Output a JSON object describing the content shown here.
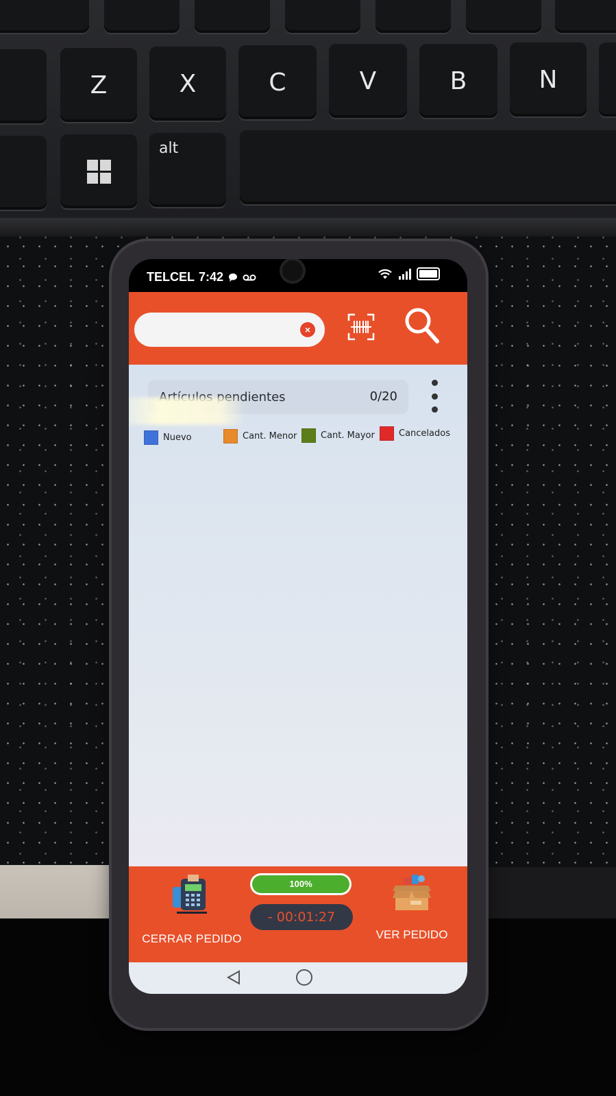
{
  "keyboard": {
    "row1": [
      "Z",
      "X",
      "C",
      "V",
      "B",
      "N"
    ],
    "alt_label": "alt"
  },
  "status": {
    "carrier": "TELCEL",
    "time": "7:42"
  },
  "header": {
    "search_placeholder": "",
    "clear_icon": "×"
  },
  "pending": {
    "label": "Artículos pendientes",
    "count": "0/20"
  },
  "legend": [
    {
      "label": "Nuevo",
      "color": "#3f72d8"
    },
    {
      "label": "Cant. Menor",
      "color": "#e8892c"
    },
    {
      "label": "Cant. Mayor",
      "color": "#5c7e18"
    },
    {
      "label": "Cancelados",
      "color": "#e02a2a"
    }
  ],
  "bottom": {
    "close_label": "CERRAR PEDIDO",
    "view_label": "VER PEDIDO",
    "progress_text": "100%",
    "progress_value": 100,
    "timer": "- 00:01:27"
  },
  "colors": {
    "accent": "#e8502a",
    "progress": "#4cae2d",
    "timer_bg": "#333847"
  }
}
